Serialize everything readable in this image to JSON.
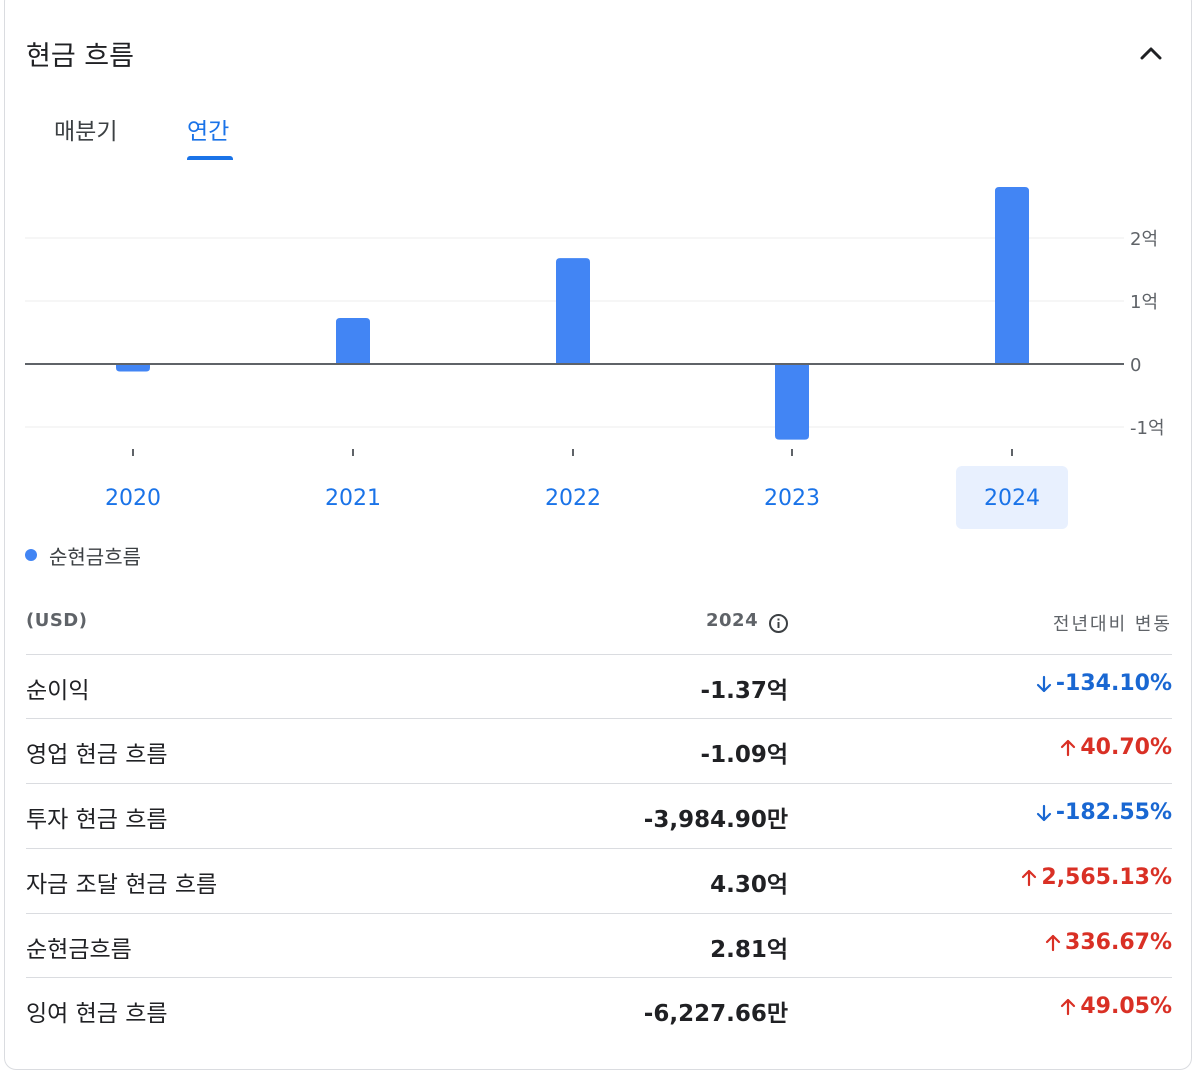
{
  "header": {
    "title": "현금 흐름"
  },
  "tabs": [
    {
      "label": "매분기",
      "selected": false
    },
    {
      "label": "연간",
      "selected": true
    }
  ],
  "chart_data": {
    "type": "bar",
    "categories": [
      "2020",
      "2021",
      "2022",
      "2023",
      "2024"
    ],
    "selected_category": "2024",
    "series": [
      {
        "name": "순현금흐름",
        "values": [
          -0.12,
          0.73,
          1.68,
          -1.2,
          2.81
        ],
        "unit": "억",
        "color": "#4285f4"
      }
    ],
    "y_ticks": [
      {
        "value": 2,
        "label": "2억"
      },
      {
        "value": 1,
        "label": "1억"
      },
      {
        "value": 0,
        "label": "0"
      },
      {
        "value": -1,
        "label": "-1억"
      }
    ],
    "ylim": [
      -1.2,
      2.81
    ],
    "grid": true,
    "legend_position": "bottom-left"
  },
  "legend": {
    "label": "순현금흐름",
    "color": "#4285f4"
  },
  "table": {
    "unit_label": "(USD)",
    "year_label": "2024",
    "change_label": "전년대비 변동",
    "rows": [
      {
        "label": "순이익",
        "value": "-1.37억",
        "change": "-134.10%",
        "direction": "down"
      },
      {
        "label": "영업 현금 흐름",
        "value": "-1.09억",
        "change": "40.70%",
        "direction": "up"
      },
      {
        "label": "투자 현금 흐름",
        "value": "-3,984.90만",
        "change": "-182.55%",
        "direction": "down"
      },
      {
        "label": "자금 조달 현금 흐름",
        "value": "4.30억",
        "change": "2,565.13%",
        "direction": "up"
      },
      {
        "label": "순현금흐름",
        "value": "2.81억",
        "change": "336.67%",
        "direction": "up"
      },
      {
        "label": "잉여 현금 흐름",
        "value": "-6,227.66만",
        "change": "49.05%",
        "direction": "up"
      }
    ]
  },
  "colors": {
    "accent": "#1a73e8",
    "bar": "#4285f4",
    "positive_change": "#d93025",
    "negative_change": "#1967d2",
    "selected_year_bg": "#e8f0fe"
  },
  "icons": {
    "collapse": "chevron-up-icon",
    "info": "info-icon",
    "up": "arrow-up-icon",
    "down": "arrow-down-icon"
  }
}
